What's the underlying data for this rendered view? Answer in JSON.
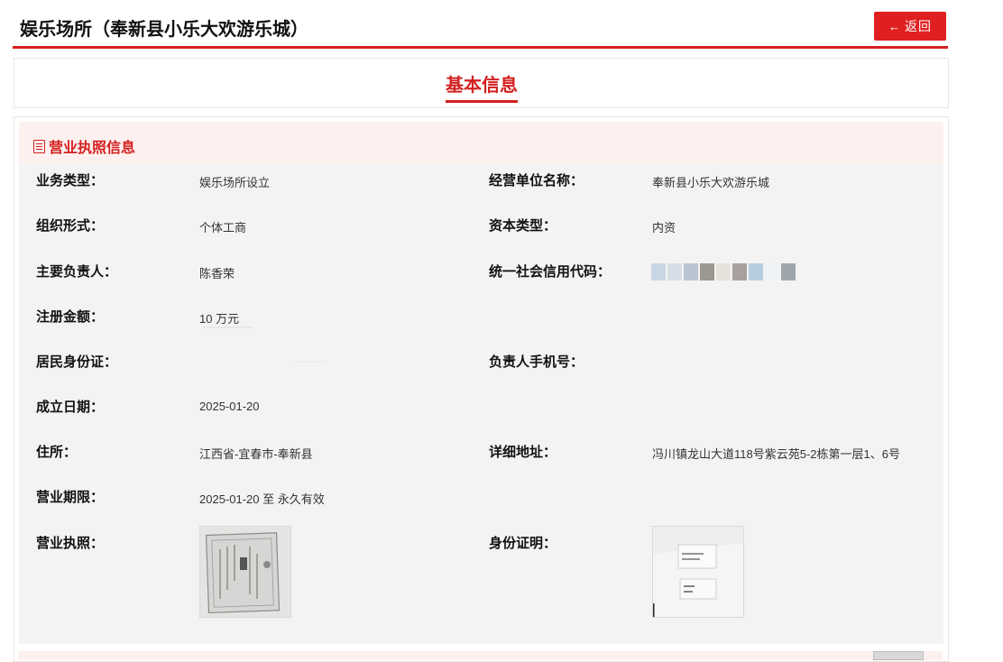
{
  "header": {
    "title": "娱乐场所（奉新县小乐大欢游乐城）",
    "back_label": "返回",
    "back_icon": "left-arrow-icon"
  },
  "tabs": [
    {
      "label": "基本信息",
      "active": true
    }
  ],
  "section": {
    "title": "营业执照信息",
    "icon": "document-icon"
  },
  "fields": {
    "business_type": {
      "label": "业务类型：",
      "value": "娱乐场所设立"
    },
    "business_name": {
      "label": "经营单位名称：",
      "value": "奉新县小乐大欢游乐城"
    },
    "org_form": {
      "label": "组织形式：",
      "value": "个体工商"
    },
    "capital_type": {
      "label": "资本类型：",
      "value": "内资"
    },
    "principal": {
      "label": "主要负责人：",
      "value": "陈香荣"
    },
    "credit_code": {
      "label": "统一社会信用代码：",
      "value": ""
    },
    "registered_capital": {
      "label": "注册金额：",
      "value": "10 万元"
    },
    "id_card": {
      "label": "居民身份证：",
      "value": ""
    },
    "phone": {
      "label": "负责人手机号：",
      "value": ""
    },
    "established": {
      "label": "成立日期：",
      "value": "2025-01-20"
    },
    "residence": {
      "label": "住所：",
      "value": "江西省-宜春市-奉新县"
    },
    "address": {
      "label": "详细地址：",
      "value": "冯川镇龙山大道118号紫云苑5-2栋第一层1、6号"
    },
    "term": {
      "label": "营业期限：",
      "value": "2025-01-20 至 永久有效"
    },
    "license": {
      "label": "营业执照："
    },
    "id_proof": {
      "label": "身份证明："
    }
  },
  "colors": {
    "accent": "#d32020",
    "section_header_bg": "#fdf1ef",
    "section_body_bg": "#f3f3f3"
  }
}
